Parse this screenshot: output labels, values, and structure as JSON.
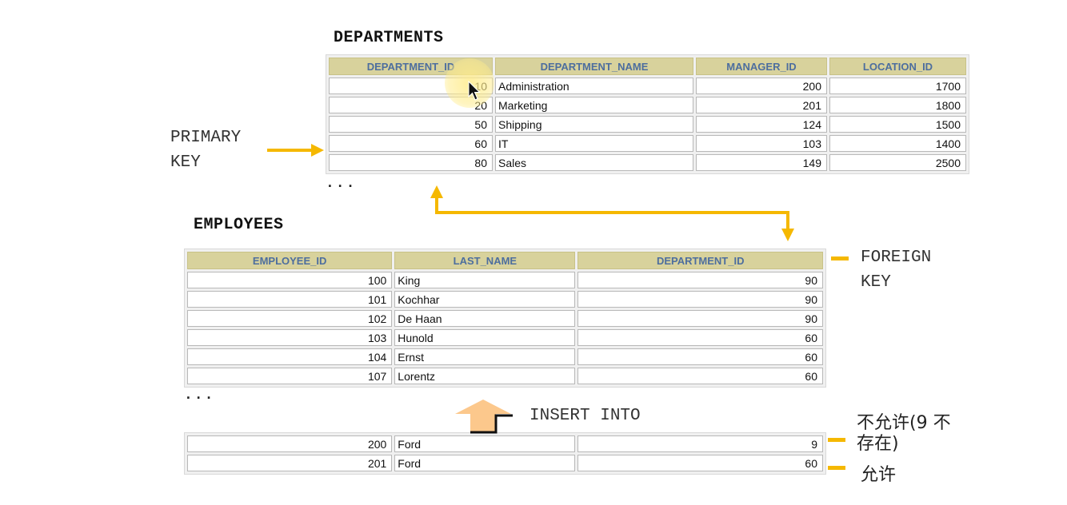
{
  "departments": {
    "title": "DEPARTMENTS",
    "headers": [
      "DEPARTMENT_ID",
      "DEPARTMENT_NAME",
      "MANAGER_ID",
      "LOCATION_ID"
    ],
    "rows": [
      [
        "10",
        "Administration",
        "200",
        "1700"
      ],
      [
        "20",
        "Marketing",
        "201",
        "1800"
      ],
      [
        "50",
        "Shipping",
        "124",
        "1500"
      ],
      [
        "60",
        "IT",
        "103",
        "1400"
      ],
      [
        "80",
        "Sales",
        "149",
        "2500"
      ]
    ],
    "ellipsis": "..."
  },
  "employees": {
    "title": "EMPLOYEES",
    "headers": [
      "EMPLOYEE_ID",
      "LAST_NAME",
      "DEPARTMENT_ID"
    ],
    "rows": [
      [
        "100",
        "King",
        "90"
      ],
      [
        "101",
        "Kochhar",
        "90"
      ],
      [
        "102",
        "De Haan",
        "90"
      ],
      [
        "103",
        "Hunold",
        "60"
      ],
      [
        "104",
        "Ernst",
        "60"
      ],
      [
        "107",
        "Lorentz",
        "60"
      ]
    ],
    "ellipsis": "..."
  },
  "insert": {
    "label": "INSERT INTO",
    "rows": [
      [
        "200",
        "Ford",
        "9"
      ],
      [
        "201",
        "Ford",
        "60"
      ]
    ]
  },
  "labels": {
    "primary_key_line1": "PRIMARY",
    "primary_key_line2": "KEY",
    "foreign_key_line1": "FOREIGN",
    "foreign_key_line2": "KEY",
    "not_allowed_line1": "不允许(9 不",
    "not_allowed_line2": "存在)",
    "allowed": "允许"
  },
  "colors": {
    "arrow": "#f5b800",
    "header_bg": "#d8d29c",
    "header_text": "#4d6e9e",
    "insert_arrow": "#fcc88c"
  }
}
